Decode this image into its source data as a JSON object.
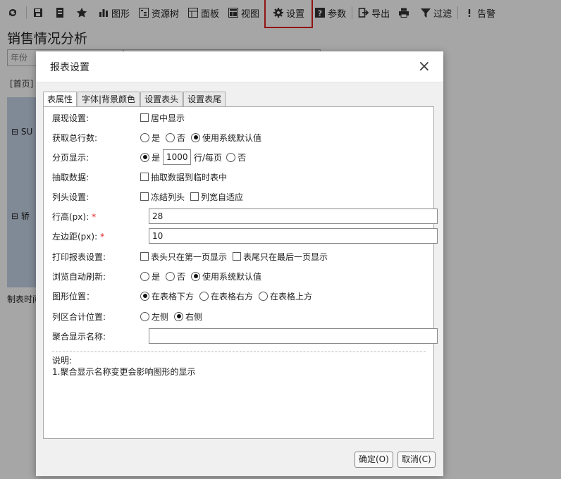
{
  "toolbar": {
    "items": [
      {
        "label": "图形",
        "icon": "bar-chart-icon"
      },
      {
        "label": "资源树",
        "icon": "tree-icon"
      },
      {
        "label": "面板",
        "icon": "panel-icon"
      },
      {
        "label": "视图",
        "icon": "view-icon"
      },
      {
        "label": "设置",
        "icon": "gear-icon"
      },
      {
        "label": "参数",
        "icon": "help-icon"
      },
      {
        "label": "导出",
        "icon": "export-icon"
      },
      {
        "label": "",
        "icon": "print-icon"
      },
      {
        "label": "过滤",
        "icon": "filter-icon"
      },
      {
        "label": "告警",
        "icon": "alert-icon"
      }
    ]
  },
  "page": {
    "title": "销售情况分析",
    "filter_label": "年份",
    "breadcrumb": "[首页]",
    "row1": "SU",
    "row2": "轿",
    "footer": "制表时间"
  },
  "dialog": {
    "title": "报表设置",
    "close": "×",
    "tabs": [
      "表属性",
      "字体|背景颜色",
      "设置表头",
      "设置表尾"
    ],
    "rows": {
      "display": {
        "label": "展现设置:",
        "opt1": "居中显示"
      },
      "total_rows": {
        "label": "获取总行数:",
        "opt1": "是",
        "opt2": "否",
        "opt3": "使用系统默认值"
      },
      "paging": {
        "label": "分页显示:",
        "opt1": "是",
        "value": "1000",
        "unit": "行/每页",
        "opt2": "否"
      },
      "extract": {
        "label": "抽取数据:",
        "opt1": "抽取数据到临时表中"
      },
      "column_header": {
        "label": "列头设置:",
        "opt1": "冻结列头",
        "opt2": "列宽自适应"
      },
      "row_height": {
        "label": "行高(px):",
        "required": "*",
        "value": "28"
      },
      "left_margin": {
        "label": "左边距(px):",
        "required": "*",
        "value": "10"
      },
      "print": {
        "label": "打印报表设置:",
        "opt1": "表头只在第一页显示",
        "opt2": "表尾只在最后一页显示"
      },
      "auto_refresh": {
        "label": "浏览自动刷新:",
        "opt1": "是",
        "opt2": "否",
        "opt3": "使用系统默认值"
      },
      "chart_position": {
        "label": "图形位置：",
        "opt1": "在表格下方",
        "opt2": "在表格右方",
        "opt3": "在表格上方"
      },
      "col_total": {
        "label": "列区合计位置:",
        "opt1": "左侧",
        "opt2": "右侧"
      },
      "agg_name": {
        "label": "聚合显示名称:",
        "value": ""
      }
    },
    "note": {
      "title": "说明:",
      "line1": "1.聚合显示名称变更会影响图形的显示"
    },
    "ok": "确定(O)",
    "cancel": "取消(C)"
  }
}
